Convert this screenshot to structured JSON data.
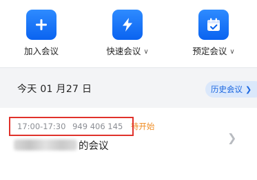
{
  "actions": [
    {
      "key": "join",
      "label": "加入会议",
      "icon": "plus-icon",
      "has_dropdown": false
    },
    {
      "key": "quick",
      "label": "快速会议",
      "icon": "lightning-icon",
      "has_dropdown": true
    },
    {
      "key": "schedule",
      "label": "预定会议",
      "icon": "calendar-icon",
      "has_dropdown": true
    }
  ],
  "date_bar": {
    "date_text": "今天  01 月27 日",
    "history_label": "历史会议",
    "history_icon": "chevron-right-icon"
  },
  "meeting": {
    "time_range": "17:00-17:30",
    "meeting_id": "949 406 145",
    "status": "待开始",
    "title_visible": "的会议"
  },
  "colors": {
    "accent": "#0a63f0",
    "status": "#ef8a1f",
    "highlight": "#e0312a",
    "date_bar_bg": "#f3f4f6"
  }
}
